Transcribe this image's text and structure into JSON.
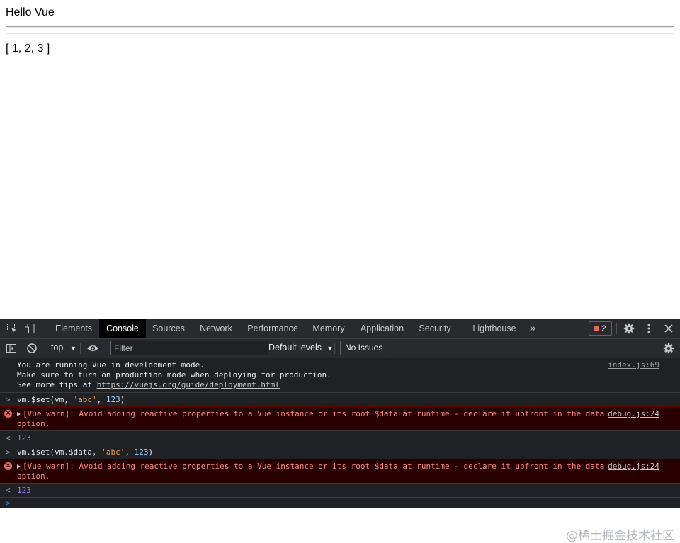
{
  "page": {
    "title": "Hello Vue",
    "array_text": "[ 1, 2, 3 ]"
  },
  "devtools": {
    "tabs": [
      "Elements",
      "Console",
      "Sources",
      "Network",
      "Performance",
      "Memory",
      "Application",
      "Security",
      "Lighthouse"
    ],
    "active_tab": "Console",
    "more_tabs": "»",
    "error_count": "2",
    "context": "top",
    "filter_placeholder": "Filter",
    "levels_label": "Default levels",
    "issues_label": "No Issues"
  },
  "console": {
    "dev_mode_lines": [
      "You are running Vue in development mode.",
      "Make sure to turn on production mode when deploying for production.",
      "See more tips at "
    ],
    "dev_mode_link": "https://vuejs.org/guide/deployment.html",
    "dev_mode_src": "index.js:69",
    "cmd1_prefix": "vm.$set(vm, ",
    "cmd1_str": "'abc'",
    "cmd1_sep": ", ",
    "cmd1_num": "123",
    "cmd1_suffix": ")",
    "warn_line1": "[Vue warn]: Avoid adding reactive properties to a Vue instance or its root $data at runtime - declare it upfront in the data",
    "warn_line2": "option.",
    "warn_src": "debug.js:24",
    "result1": "123",
    "cmd2_prefix": "vm.$set(vm.$data, ",
    "cmd2_str": "'abc'",
    "cmd2_sep": ", ",
    "cmd2_num": "123",
    "cmd2_suffix": ")",
    "result2": "123",
    "watermark": "@稀土掘金技术社区"
  },
  "colors": {
    "error_bg": "#290000",
    "error_text": "#f28b82",
    "string": "#ee9a5a",
    "number": "#9980ff"
  }
}
